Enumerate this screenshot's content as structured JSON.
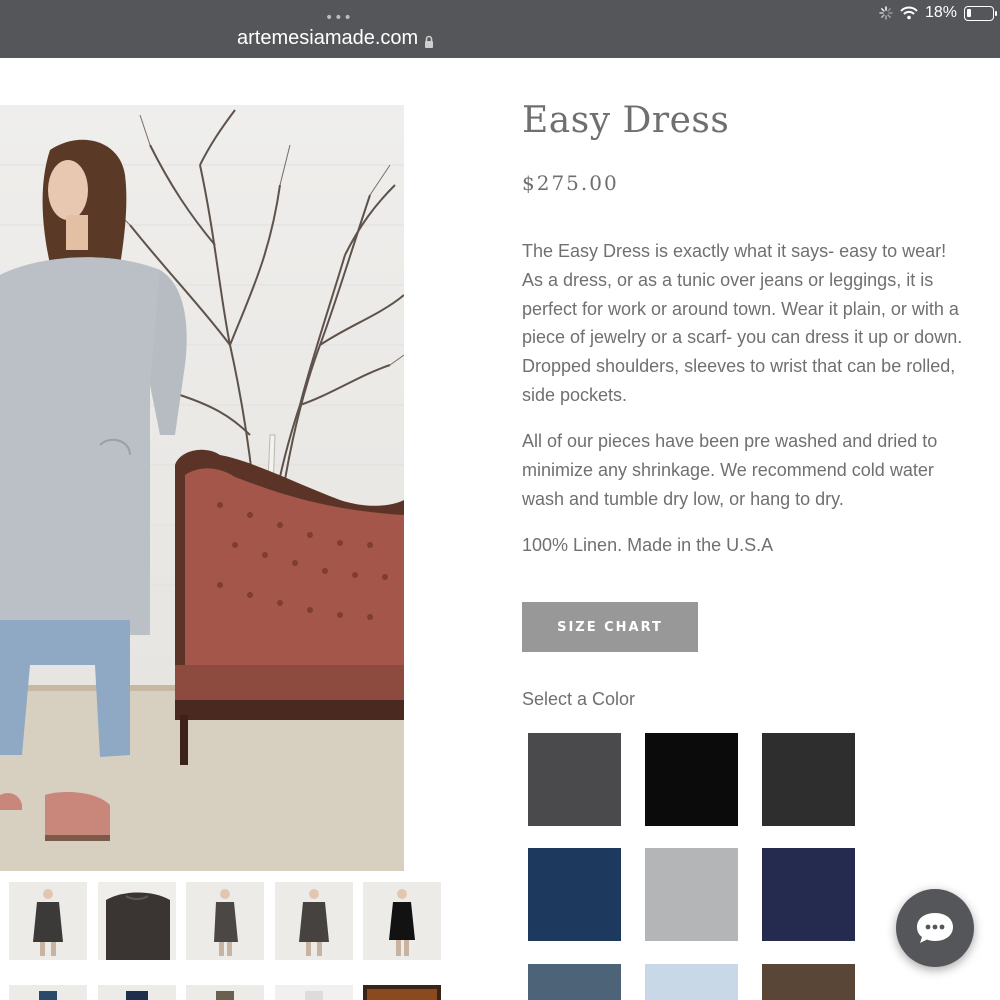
{
  "browser": {
    "url": "artemesiamade.com",
    "battery_text": "18%",
    "battery_level": 0.18
  },
  "product": {
    "title": "Easy Dress",
    "price": "$275.00",
    "description": [
      "The Easy Dress is exactly what it says- easy to wear! As a dress, or as a tunic over jeans or leggings, it is perfect for work or around town. Wear it plain, or with a piece of jewelry or a scarf- you can dress it up or down. Dropped shoulders, sleeves to wrist that can be rolled, side pockets.",
      "All of our pieces have been pre washed and dried to minimize any shrinkage. We recommend cold water wash and tumble dry low, or hang to dry.",
      "100% Linen. Made in the U.S.A"
    ],
    "size_chart_label": "SIZE CHART",
    "select_color_label": "Select a Color"
  },
  "swatches": [
    {
      "color": "#4a4a4c"
    },
    {
      "color": "#0b0b0b"
    },
    {
      "color": "#2e2e2f"
    },
    {
      "color": "#1d3a5e"
    },
    {
      "color": "#b4b5b6"
    },
    {
      "color": "#252b4e"
    },
    {
      "color": "#4d6478"
    },
    {
      "color": "#c9d8e6"
    },
    {
      "color": "#5a4637"
    }
  ],
  "icons": {
    "lock": "lock-icon",
    "wifi": "wifi-icon",
    "battery": "battery-icon",
    "chat": "chat-icon"
  }
}
